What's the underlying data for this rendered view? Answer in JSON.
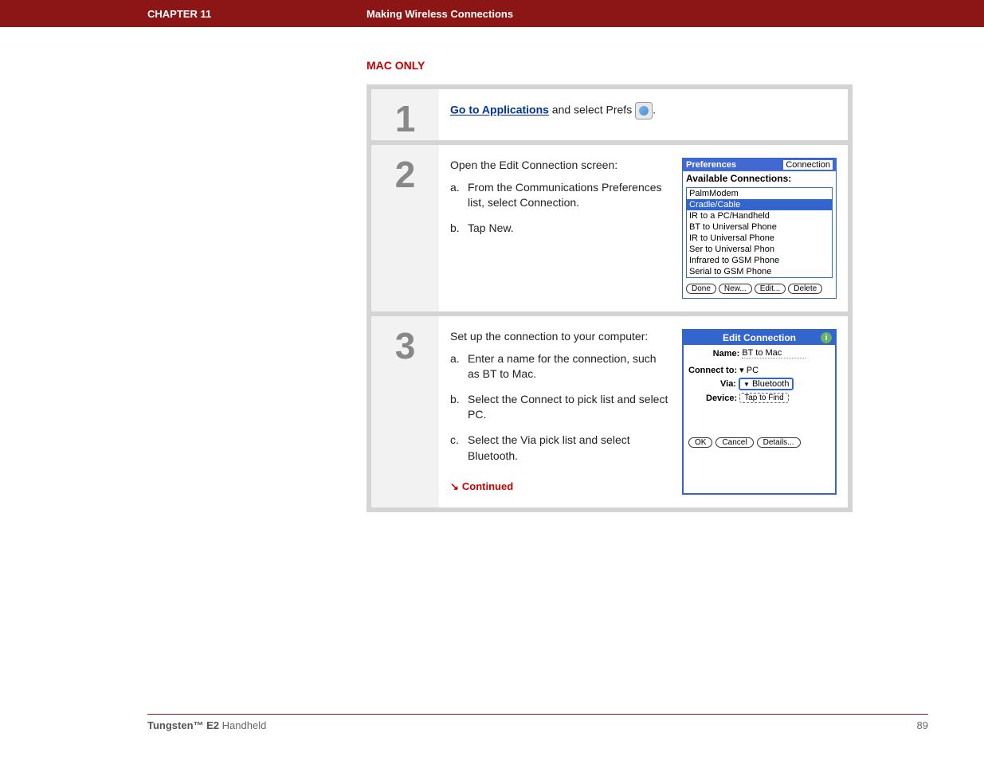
{
  "banner": {
    "chapter": "CHAPTER 11",
    "title": "Making Wireless Connections"
  },
  "section_label": "MAC ONLY",
  "steps": {
    "s1": {
      "num": "1",
      "link_text": "Go to Applications",
      "after_link": " and select Prefs ",
      "period": "."
    },
    "s2": {
      "num": "2",
      "intro": "Open the Edit Connection screen:",
      "a_marker": "a.",
      "a": "From the Communications Preferences list, select Connection.",
      "b_marker": "b.",
      "b": "Tap New."
    },
    "s3": {
      "num": "3",
      "intro": "Set up the connection to your computer:",
      "a_marker": "a.",
      "a": "Enter a name for the connection, such as BT to Mac.",
      "b_marker": "b.",
      "b": "Select the Connect to pick list and select PC.",
      "c_marker": "c.",
      "c": "Select the Via pick list and select Bluetooth.",
      "continued": "Continued"
    }
  },
  "palm1": {
    "title_left": "Preferences",
    "title_right": "Connection",
    "heading": "Available Connections:",
    "items": [
      "PalmModem",
      "Cradle/Cable",
      "IR to a PC/Handheld",
      "BT to Universal Phone",
      "IR to Universal Phone",
      "Ser to Universal Phon",
      "Infrared to GSM Phone",
      "Serial to GSM Phone"
    ],
    "selected_index": 1,
    "buttons": {
      "done": "Done",
      "new": "New...",
      "edit": "Edit...",
      "delete": "Delete"
    }
  },
  "palm2": {
    "title": "Edit Connection",
    "info": "i",
    "name_label": "Name:",
    "name_value": "BT to Mac",
    "connect_label": "Connect to:",
    "connect_value": "PC",
    "via_label": "Via:",
    "via_value": "Bluetooth",
    "device_label": "Device:",
    "device_value": "Tap to Find",
    "buttons": {
      "ok": "OK",
      "cancel": "Cancel",
      "details": "Details..."
    }
  },
  "footer": {
    "product_bold": "Tungsten™ E2",
    "product_rest": " Handheld",
    "page": "89"
  }
}
